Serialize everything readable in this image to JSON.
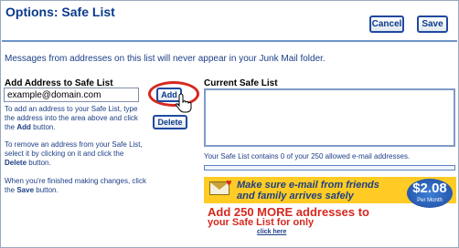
{
  "header": {
    "title": "Options: Safe List",
    "cancel_label": "Cancel",
    "save_label": "Save"
  },
  "info_text": "Messages from addresses on this list will never appear in your Junk Mail folder.",
  "add_section": {
    "label": "Add Address to Safe List",
    "input_value": "example@domain.com",
    "add_label": "Add",
    "delete_label": "Delete",
    "help_add_pre": "To add an address to your Safe List, type the address into the area above and click the ",
    "help_add_bold": "Add",
    "help_add_post": " button.",
    "help_remove_pre": "To remove an address from your Safe List, select it by clicking on it and click the ",
    "help_remove_bold": "Delete",
    "help_remove_post": " button.",
    "help_done_pre": "When you're finished making changes, click the ",
    "help_done_bold": "Save",
    "help_done_post": " button."
  },
  "current_section": {
    "label": "Current Safe List",
    "count_text": "Your Safe List contains 0 of your 250 allowed e-mail addresses."
  },
  "ad": {
    "line1": "Make sure e-mail from friends",
    "line2": "and family arrives safely",
    "main1": "Add 250 MORE addresses to",
    "main2": "your Safe List for only",
    "price": "$2.08",
    "per": "Per Month",
    "link": "click here"
  },
  "colors": {
    "accent": "#1f4aa0",
    "title": "#0a3a8c",
    "highlight": "#d6281f",
    "ad_bg": "#ffcb24"
  }
}
